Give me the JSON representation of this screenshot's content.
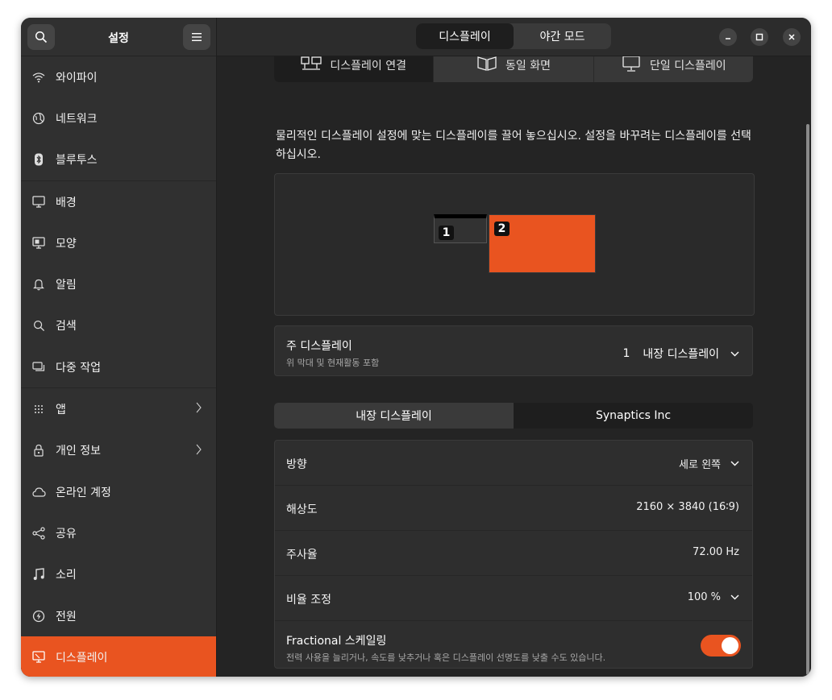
{
  "sidebar": {
    "title": "설정",
    "search_icon": "search-icon",
    "menu_icon": "hamburger-menu-icon",
    "items": [
      {
        "label": "와이파이",
        "icon": "wifi-icon"
      },
      {
        "label": "네트워크",
        "icon": "network-globe-icon"
      },
      {
        "label": "블루투스",
        "icon": "bluetooth-icon"
      },
      {
        "label": "배경",
        "icon": "background-monitor-icon"
      },
      {
        "label": "모양",
        "icon": "appearance-icon"
      },
      {
        "label": "알림",
        "icon": "bell-icon"
      },
      {
        "label": "검색",
        "icon": "search-icon"
      },
      {
        "label": "다중 작업",
        "icon": "multitasking-icon"
      },
      {
        "label": "앱",
        "icon": "apps-grid-icon"
      },
      {
        "label": "개인 정보",
        "icon": "lock-icon"
      },
      {
        "label": "온라인 계정",
        "icon": "cloud-icon"
      },
      {
        "label": "공유",
        "icon": "share-icon"
      },
      {
        "label": "소리",
        "icon": "music-note-icon"
      },
      {
        "label": "전원",
        "icon": "power-icon"
      },
      {
        "label": "디스플레이",
        "icon": "display-icon"
      }
    ]
  },
  "header": {
    "tabs": [
      "디스플레이",
      "야간 모드"
    ],
    "active_tab": "디스플레이"
  },
  "modes": [
    "디스플레이 연결",
    "동일 화면",
    "단일 디스플레이"
  ],
  "description": "물리적인 디스플레이 설정에 맞는 디스플레이를 끌어 놓으십시오. 설정을 바꾸려는 디스플레이를 선택하십시오.",
  "arrangement": {
    "monitor1": "1",
    "monitor2": "2"
  },
  "primary": {
    "label": "주 디스플레이",
    "sublabel": "위 막대 및 현재활동 포함",
    "number": "1",
    "value": "내장 디스플레이"
  },
  "display_tabs": [
    "내장 디스플레이",
    "Synaptics Inc"
  ],
  "settings": {
    "orientation": {
      "label": "방향",
      "value": "세로 왼쪽"
    },
    "resolution": {
      "label": "해상도",
      "value": "2160 × 3840 (16∶9)"
    },
    "refresh": {
      "label": "주사율",
      "value": "72.00 Hz"
    },
    "scale": {
      "label": "비율 조정",
      "value": "100 %"
    },
    "fractional": {
      "label": "Fractional 스케일링",
      "sublabel": "전력 사용을 늘리거나, 속도를 낮추거나 혹은 디스플레이 선명도를 낮출 수도 있습니다.",
      "enabled": true
    }
  },
  "colors": {
    "accent": "#e95420",
    "window_bg": "#242424",
    "sidebar_bg": "#303030"
  }
}
